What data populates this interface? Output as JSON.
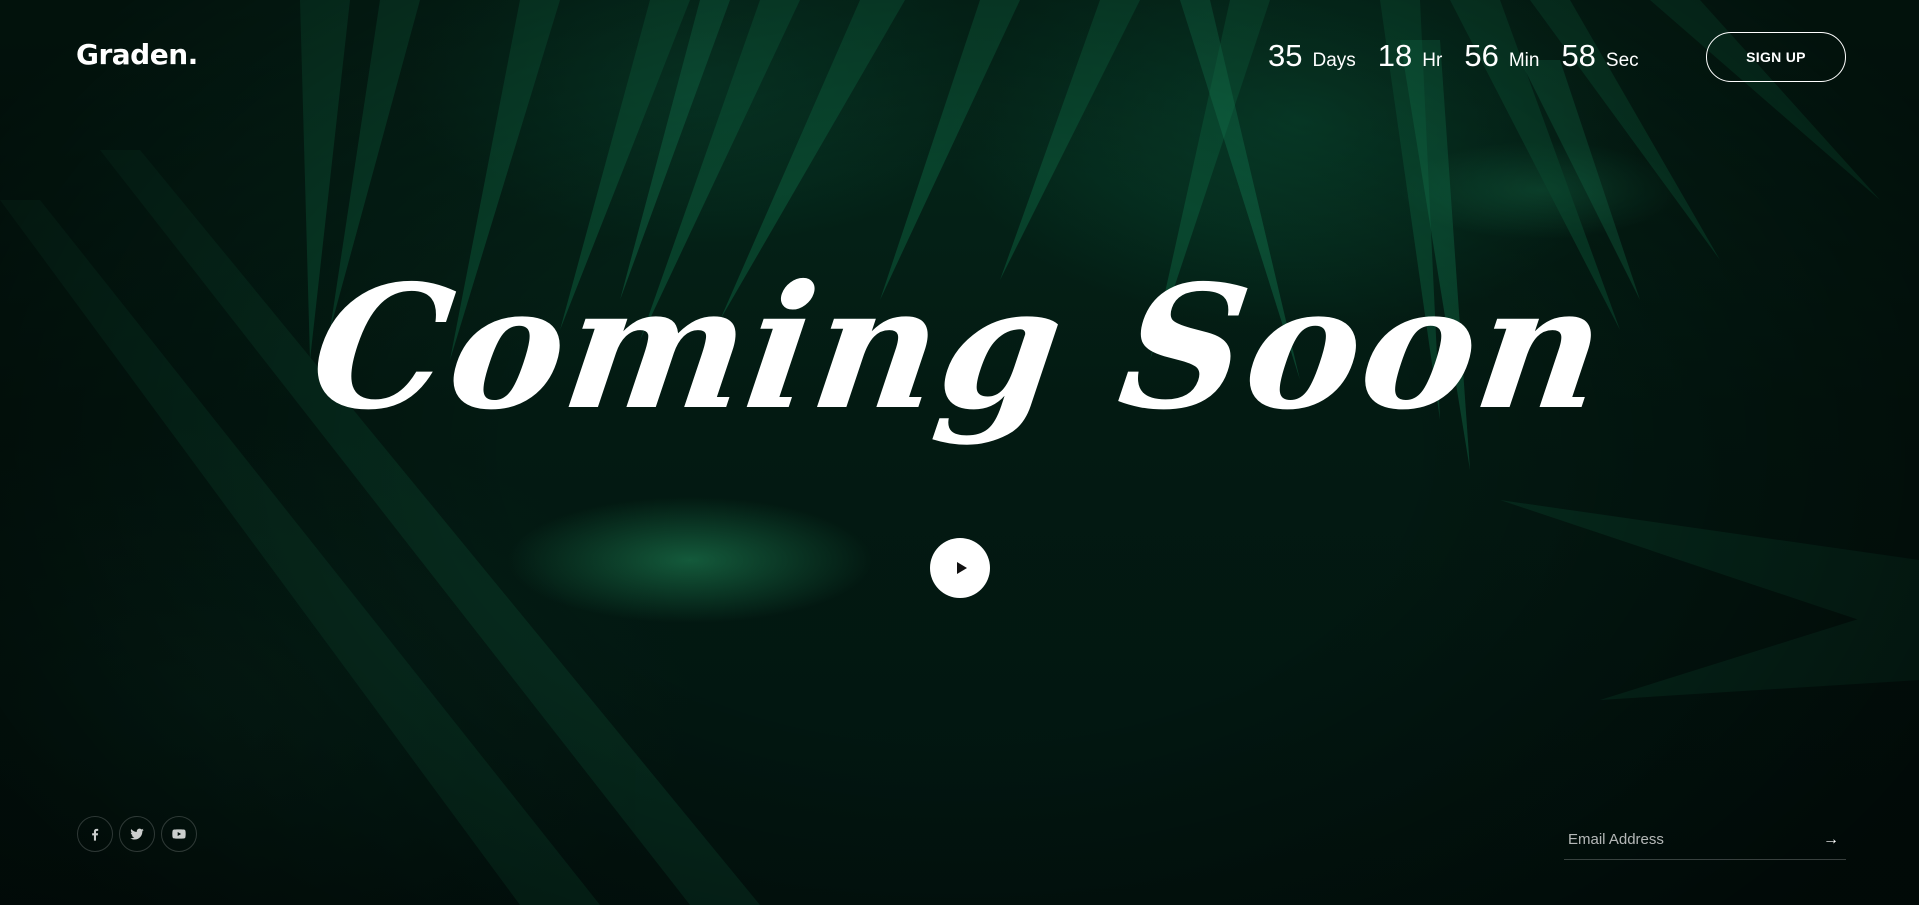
{
  "brand": {
    "logo_text": "Graden."
  },
  "countdown": [
    {
      "value": "35",
      "label": "Days"
    },
    {
      "value": "18",
      "label": "Hr"
    },
    {
      "value": "56",
      "label": "Min"
    },
    {
      "value": "58",
      "label": "Sec"
    }
  ],
  "header": {
    "signup_label": "SIGN UP"
  },
  "hero": {
    "title": "Coming Soon"
  },
  "social": [
    {
      "name": "facebook",
      "icon": "facebook-icon"
    },
    {
      "name": "twitter",
      "icon": "twitter-icon"
    },
    {
      "name": "youtube",
      "icon": "youtube-icon"
    }
  ],
  "newsletter": {
    "placeholder": "Email Address",
    "submit_icon": "arrow-right-icon",
    "submit_glyph": "→"
  },
  "colors": {
    "background": "#041a12",
    "foliage": "#0f6b45",
    "text": "#ffffff",
    "button_bg": "#ffffff"
  }
}
